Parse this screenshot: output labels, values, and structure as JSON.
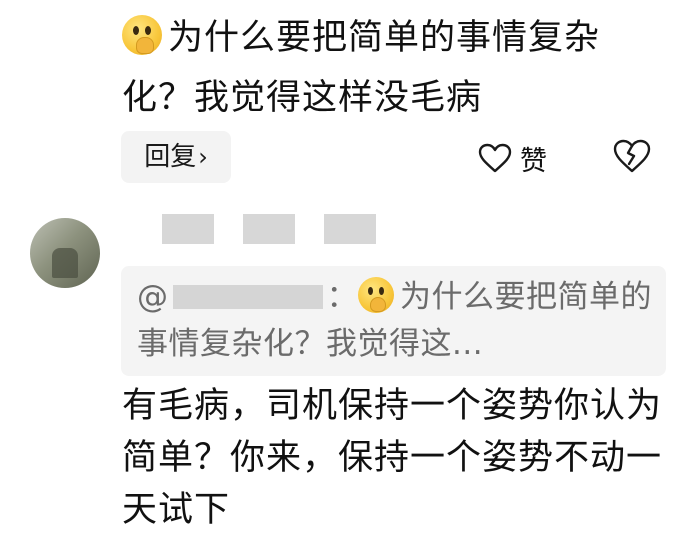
{
  "top_comment": {
    "text": "为什么要把简单的事情复杂化？我觉得这样没毛病",
    "emoji": "thinking-face-emoji"
  },
  "actions": {
    "reply_label": "回复",
    "reply_chevron": "›",
    "like_label": "赞",
    "like_icon": "heart-icon",
    "dislike_icon": "broken-heart-icon"
  },
  "reply": {
    "quote_prefix": "@",
    "quote_separator": "：",
    "quote_text": "为什么要把简单的事情复杂化？我觉得这...",
    "body": "有毛病，司机保持一个姿势你认为简单？你来，保持一个姿势不动一天试下"
  },
  "colors": {
    "text": "#111111",
    "secondary_text": "#6b6b6b",
    "button_bg": "#f3f3f3"
  }
}
